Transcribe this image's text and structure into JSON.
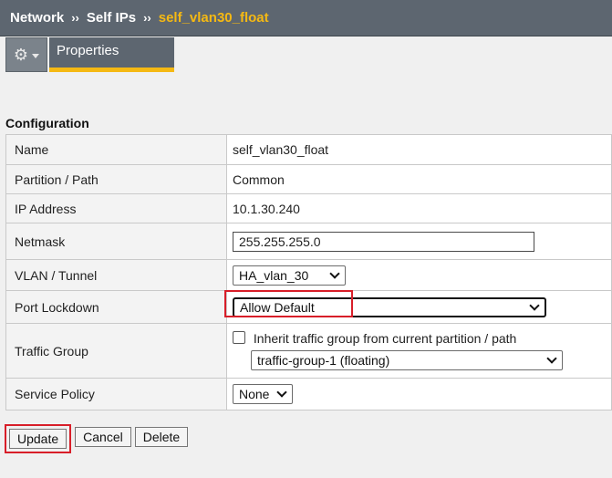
{
  "breadcrumb": {
    "items": [
      "Network",
      "Self IPs"
    ],
    "separator": "››",
    "current": "self_vlan30_float"
  },
  "tabs": {
    "properties": "Properties"
  },
  "icons": {
    "menu": "gear-icon",
    "dropdown": "chevron-down-icon"
  },
  "section": {
    "title": "Configuration"
  },
  "fields": {
    "name": {
      "label": "Name",
      "value": "self_vlan30_float"
    },
    "partition": {
      "label": "Partition / Path",
      "value": "Common"
    },
    "ip_address": {
      "label": "IP Address",
      "value": "10.1.30.240"
    },
    "netmask": {
      "label": "Netmask",
      "value": "255.255.255.0"
    },
    "vlan": {
      "label": "VLAN / Tunnel",
      "value": "HA_vlan_30"
    },
    "port_lockdown": {
      "label": "Port Lockdown",
      "value": "Allow Default"
    },
    "traffic_group": {
      "label": "Traffic Group",
      "inherit_label": "Inherit traffic group from current partition / path",
      "inherit_checked": false,
      "value": "traffic-group-1 (floating)"
    },
    "service_policy": {
      "label": "Service Policy",
      "value": "None"
    }
  },
  "actions": {
    "update": "Update",
    "cancel": "Cancel",
    "delete": "Delete"
  },
  "colors": {
    "header_bg": "#5d6670",
    "accent": "#f5b913",
    "highlight": "#d81e29"
  }
}
